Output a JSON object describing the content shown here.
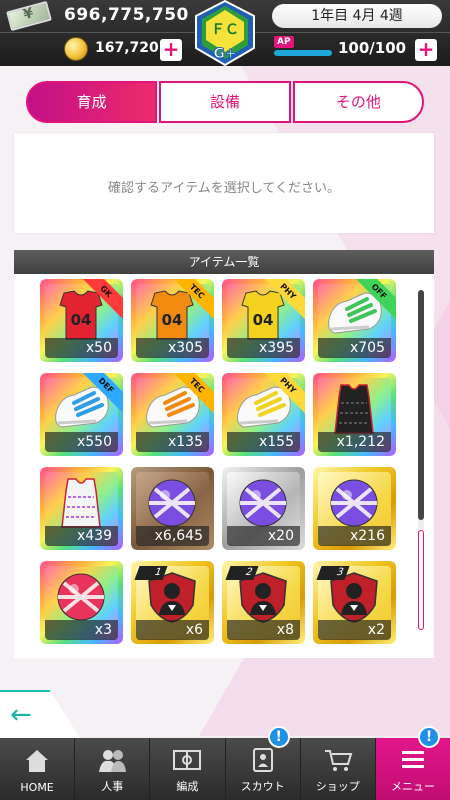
{
  "status": {
    "money": "696,775,750",
    "coins": "167,720",
    "week": "1年目 4月 4週",
    "ap_label": "AP",
    "ap": "100/100",
    "ap_fill": 1.0,
    "emblem_rank": "G+"
  },
  "tabs": [
    "育成",
    "設備",
    "その他"
  ],
  "message": "確認するアイテムを選択してください。",
  "list_title": "アイテム一覧",
  "items": [
    {
      "art": "jersey",
      "color": "#e3232f",
      "num": "04",
      "tag": "GK",
      "frame": "rainbow",
      "count": "x50"
    },
    {
      "art": "jersey",
      "color": "#f08a10",
      "num": "04",
      "tag": "TEC",
      "frame": "rainbow",
      "count": "x305"
    },
    {
      "art": "jersey",
      "color": "#f2d21e",
      "num": "04",
      "tag": "PHY",
      "frame": "rainbow",
      "count": "x395"
    },
    {
      "art": "shoe",
      "color": "#3fc45a",
      "tag": "OFF",
      "frame": "rainbow",
      "count": "x705"
    },
    {
      "art": "shoe",
      "color": "#2e9ee8",
      "tag": "DEF",
      "frame": "rainbow",
      "count": "x550"
    },
    {
      "art": "shoe",
      "color": "#f08a10",
      "tag": "TEC",
      "frame": "rainbow",
      "count": "x135"
    },
    {
      "art": "shoe",
      "color": "#f2d21e",
      "tag": "PHY",
      "frame": "rainbow",
      "count": "x155"
    },
    {
      "art": "vest",
      "color": "#222222",
      "frame": "rainbow",
      "count": "x1,212"
    },
    {
      "art": "vest",
      "color": "#f4f4f4",
      "frame": "rainbow",
      "count": "x439"
    },
    {
      "art": "ball",
      "color": "#7a4ee0",
      "frame": "bronze",
      "count": "x6,645"
    },
    {
      "art": "ball",
      "color": "#7a4ee0",
      "frame": "silver",
      "count": "x20"
    },
    {
      "art": "ball",
      "color": "#7a4ee0",
      "frame": "gold",
      "count": "x216"
    },
    {
      "art": "ball",
      "color": "#e8335a",
      "frame": "rainbow",
      "count": "x3"
    },
    {
      "art": "shield",
      "color": "#c0202a",
      "lv": "1",
      "frame": "gold",
      "count": "x6"
    },
    {
      "art": "shield",
      "color": "#c0202a",
      "lv": "2",
      "frame": "gold",
      "count": "x8"
    },
    {
      "art": "shield",
      "color": "#c0202a",
      "lv": "3",
      "frame": "gold",
      "count": "x2"
    }
  ],
  "nav": [
    {
      "label": "HOME",
      "icon": "home-icon"
    },
    {
      "label": "人事",
      "icon": "people-icon"
    },
    {
      "label": "編成",
      "icon": "pitch-icon"
    },
    {
      "label": "スカウト",
      "icon": "scout-icon",
      "badge": "!"
    },
    {
      "label": "ショップ",
      "icon": "cart-icon"
    },
    {
      "label": "メニュー",
      "icon": "menu-icon",
      "badge": "!"
    }
  ],
  "back_icon": "back-arrow-icon"
}
